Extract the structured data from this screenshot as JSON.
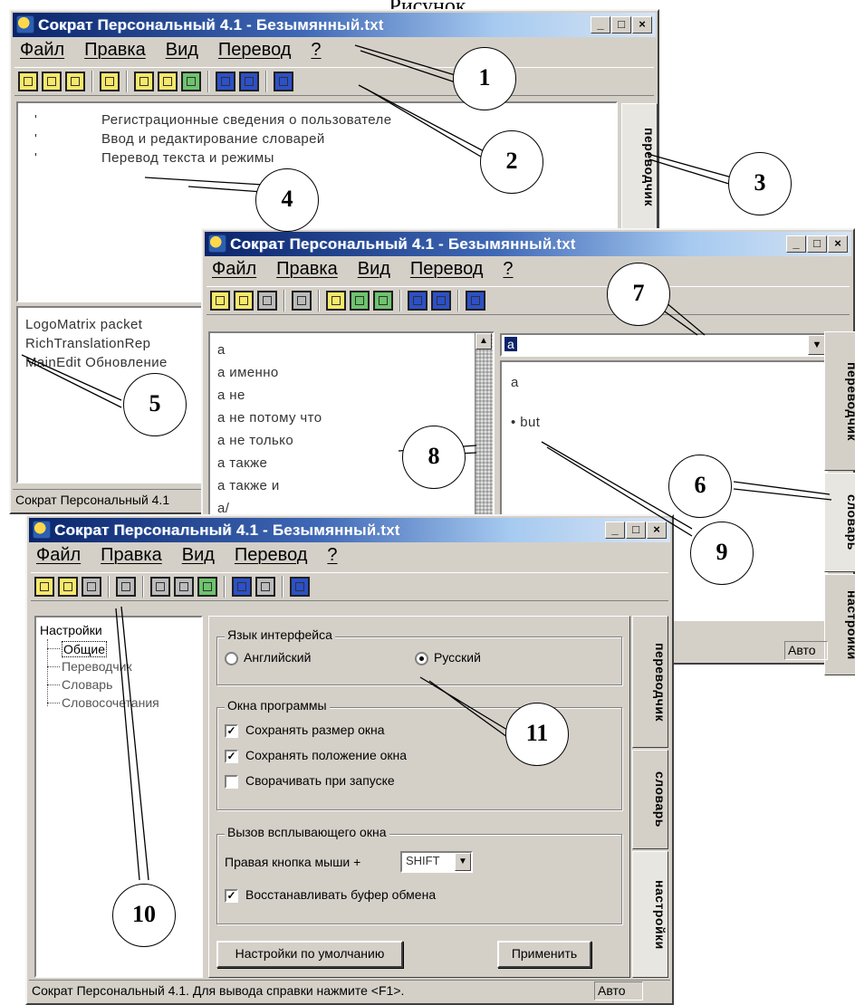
{
  "top_caption": "Рисунок",
  "win1": {
    "title": "Сократ Персональный 4.1 - Безымянный.txt",
    "menu": [
      "Файл",
      "Правка",
      "Вид",
      "Перевод",
      "?"
    ],
    "source_lines": [
      "Регистрационные сведения о пользователе",
      "Ввод и редактирование словарей",
      "Перевод текста и режимы"
    ],
    "result_lines": [
      "LogoMatrix packet",
      "RichTranslationRep",
      "MainEdit Обновление"
    ],
    "tab_translator": "переводчик",
    "status": "Сократ Персональный 4.1"
  },
  "win2": {
    "title": "Сократ Персональный 4.1 - Безымянный.txt",
    "menu": [
      "Файл",
      "Правка",
      "Вид",
      "Перевод",
      "?"
    ],
    "word_list": [
      "a",
      "a именно",
      "a не",
      "a не потому что",
      "a не только",
      "a также",
      "a также и",
      "a/"
    ],
    "search_value": "a",
    "entry_lines": [
      "a",
      "• but"
    ],
    "tab_translator": "переводчик",
    "tab_dictionary": "словарь",
    "tab_settings": "настройки",
    "status_auto": "Авто"
  },
  "win3": {
    "title": "Сократ Персональный 4.1 - Безымянный.txt",
    "menu": [
      "Файл",
      "Правка",
      "Вид",
      "Перевод",
      "?"
    ],
    "tree_root": "Настройки",
    "tree_items": [
      "Общие",
      "Переводчик",
      "Словарь",
      "Словосочетания"
    ],
    "group_language": "Язык интерфейса",
    "radio_english": "Английский",
    "radio_russian": "Русский",
    "group_windows": "Окна программы",
    "check_save_size": "Сохранять размер окна",
    "check_save_pos": "Сохранять положение окна",
    "check_minimize": "Сворачивать при запуске",
    "group_popup": "Вызов всплывающего окна",
    "popup_label": "Правая кнопка мыши +",
    "popup_key": "SHIFT",
    "check_restore_buffer": "Восстанавливать буфер обмена",
    "btn_defaults": "Настройки по умолчанию",
    "btn_apply": "Применить",
    "tab_translator": "переводчик",
    "tab_dictionary": "словарь",
    "tab_settings": "настройки",
    "status": "Сократ Персональный 4.1. Для вывода справки нажмите <F1>.",
    "status_auto": "Авто"
  },
  "callouts": [
    "1",
    "2",
    "3",
    "4",
    "5",
    "6",
    "7",
    "8",
    "9",
    "10",
    "11"
  ]
}
